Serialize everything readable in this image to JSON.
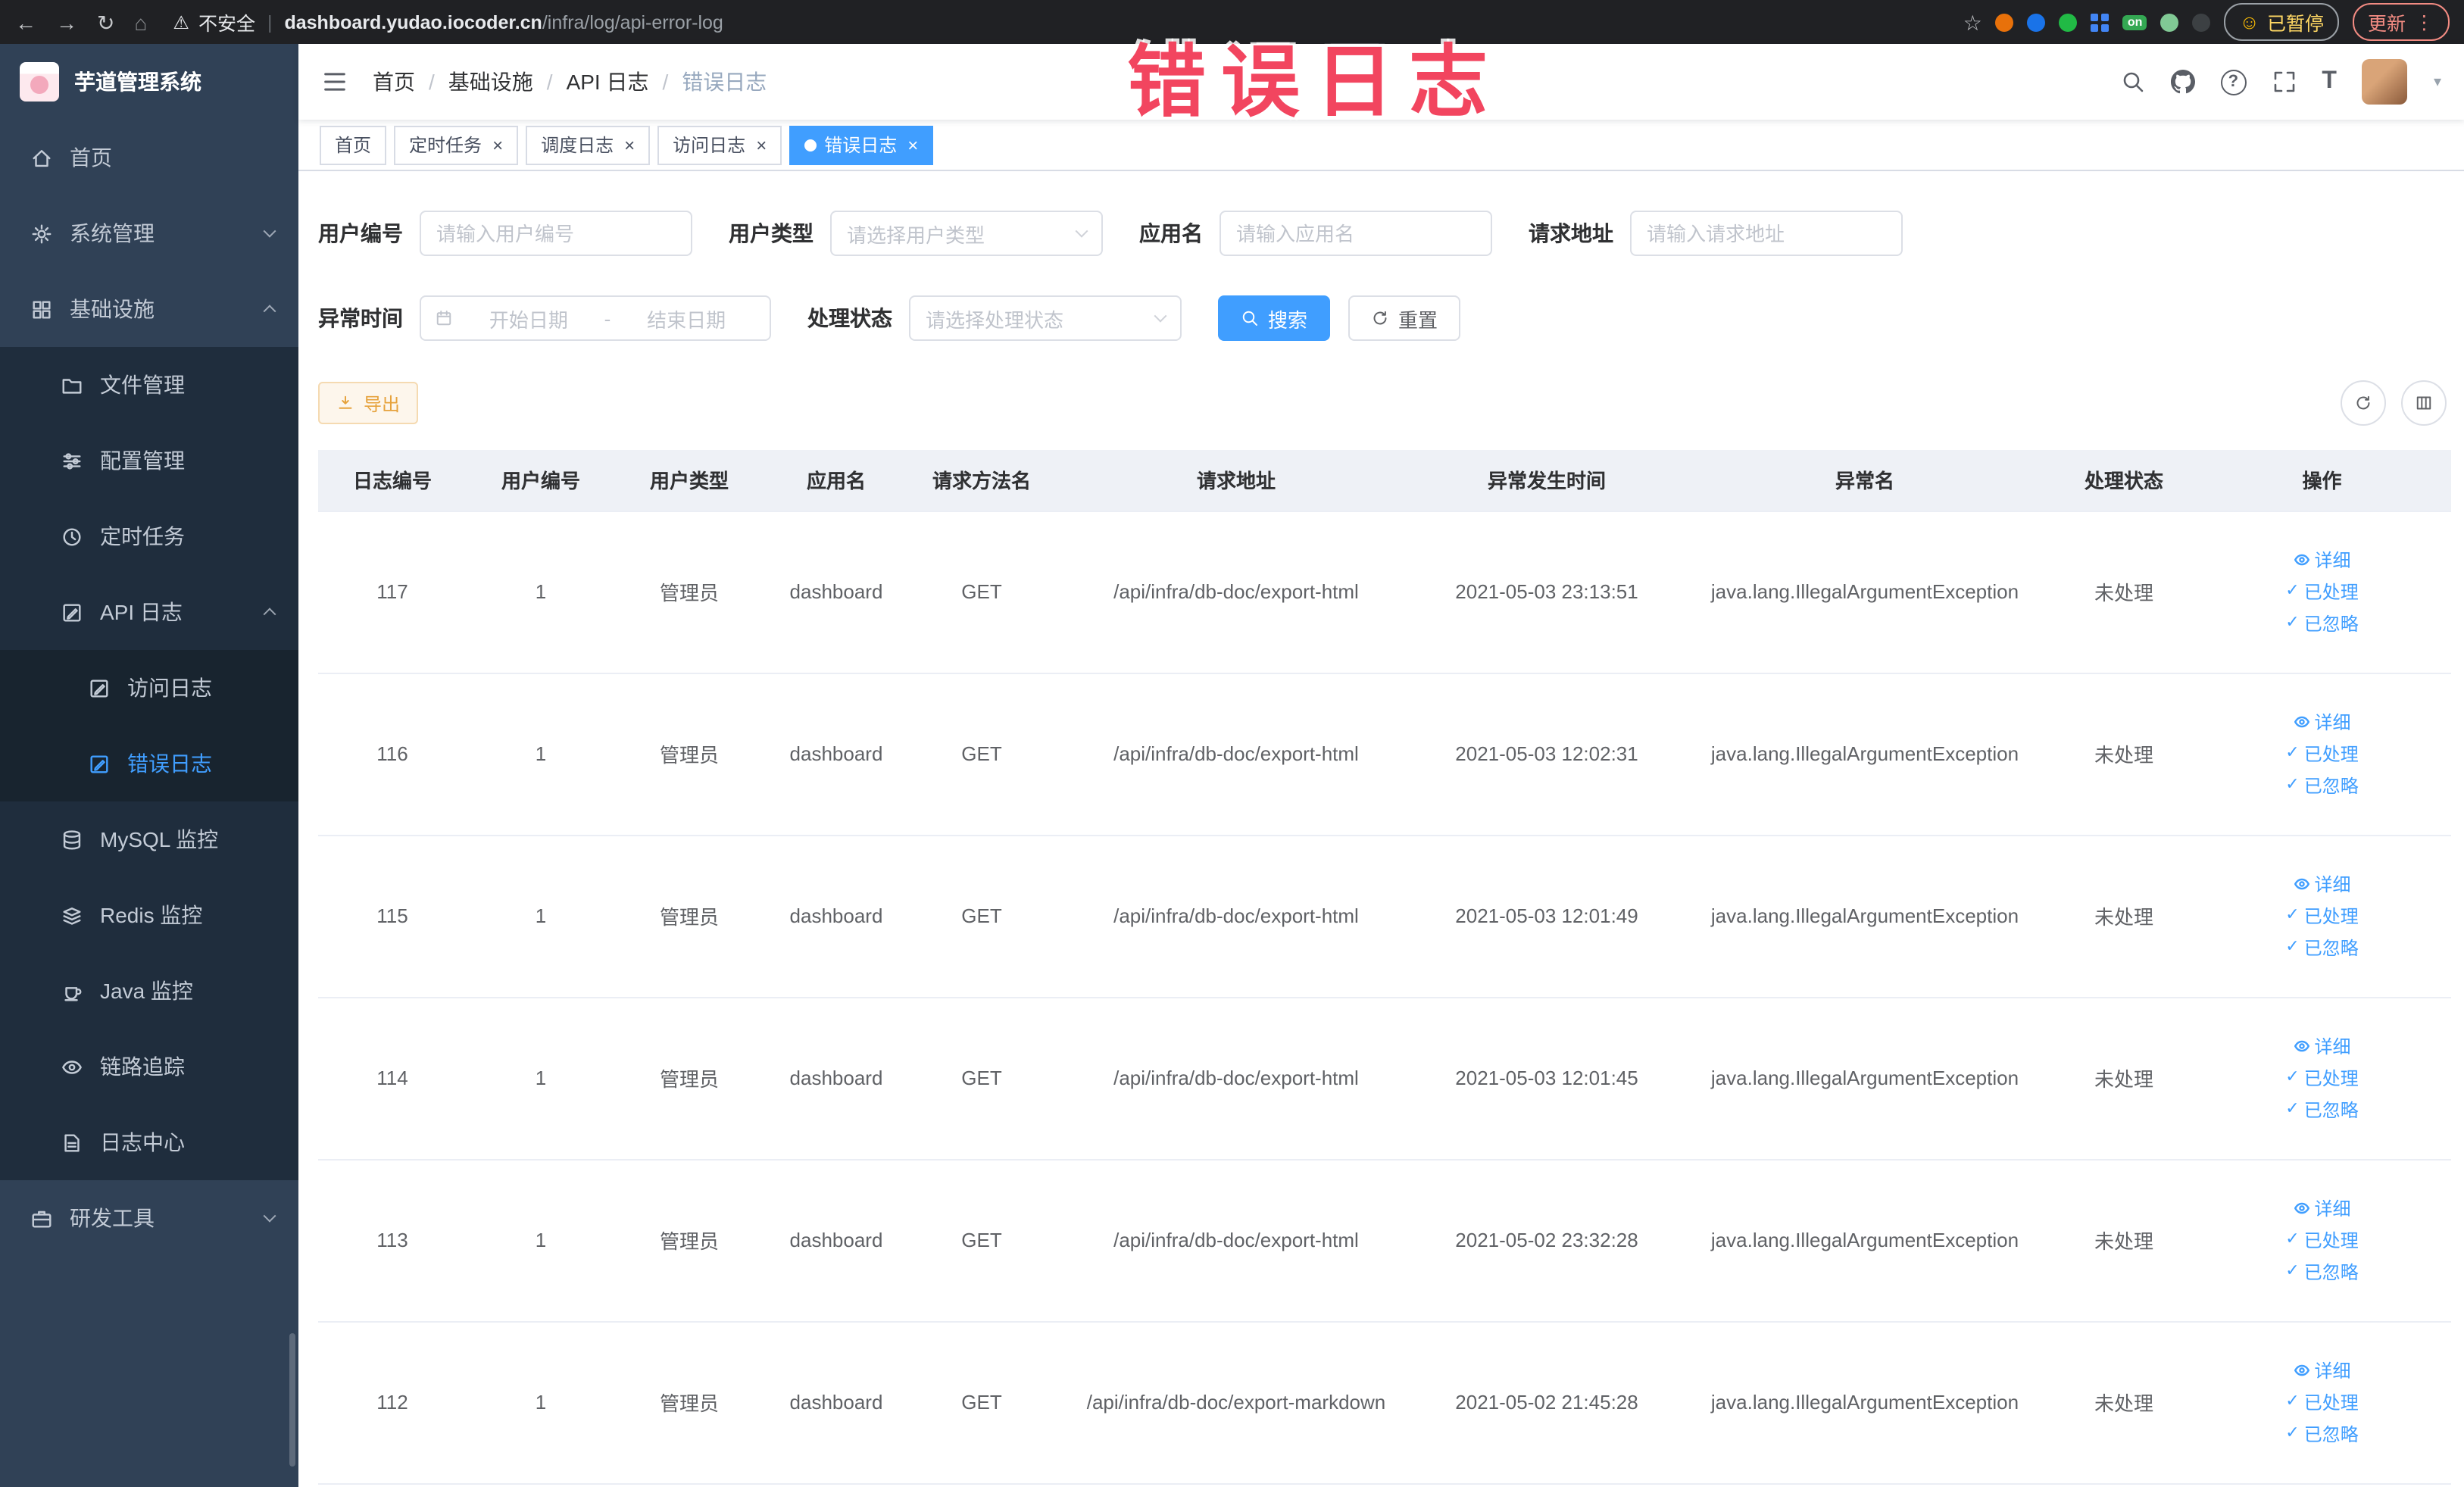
{
  "colors": {
    "primary": "#409EFF",
    "warning": "#E6A23C",
    "sidebar_bg": "#304156",
    "overlay_red": "#f2455f"
  },
  "icons": {
    "back": "←",
    "forward": "→",
    "refresh": "↻",
    "home": "⌂",
    "warning": "⚠",
    "star": "☆",
    "dots": "⋮",
    "smiley": "☺",
    "caret_down": "▾",
    "close": "×",
    "check": "✓",
    "help": "?",
    "font_size": "T"
  },
  "browser": {
    "security_label": "不安全",
    "url_domain": "dashboard.yudao.iocoder.cn",
    "url_path": "/infra/log/api-error-log",
    "extension_on_badge": "on",
    "paused_badge": "已暂停",
    "update_button": "更新"
  },
  "overlay_title": "错误日志",
  "sidebar": {
    "logo_title": "芋道管理系统",
    "items": [
      {
        "label": "首页"
      },
      {
        "label": "系统管理"
      },
      {
        "label": "基础设施"
      },
      {
        "label": "文件管理"
      },
      {
        "label": "配置管理"
      },
      {
        "label": "定时任务"
      },
      {
        "label": "API 日志"
      },
      {
        "label": "访问日志"
      },
      {
        "label": "错误日志"
      },
      {
        "label": "MySQL 监控"
      },
      {
        "label": "Redis 监控"
      },
      {
        "label": "Java 监控"
      },
      {
        "label": "链路追踪"
      },
      {
        "label": "日志中心"
      },
      {
        "label": "研发工具"
      }
    ]
  },
  "breadcrumb": {
    "items": [
      "首页",
      "基础设施",
      "API 日志",
      "错误日志"
    ]
  },
  "tabs": [
    {
      "label": "首页"
    },
    {
      "label": "定时任务"
    },
    {
      "label": "调度日志"
    },
    {
      "label": "访问日志"
    },
    {
      "label": "错误日志"
    }
  ],
  "filters": {
    "user_id_label": "用户编号",
    "user_id_placeholder": "请输入用户编号",
    "user_type_label": "用户类型",
    "user_type_placeholder": "请选择用户类型",
    "app_name_label": "应用名",
    "app_name_placeholder": "请输入应用名",
    "request_url_label": "请求地址",
    "request_url_placeholder": "请输入请求地址",
    "exception_time_label": "异常时间",
    "date_start_placeholder": "开始日期",
    "date_separator": "-",
    "date_end_placeholder": "结束日期",
    "process_status_label": "处理状态",
    "process_status_placeholder": "请选择处理状态",
    "search_button": "搜索",
    "reset_button": "重置"
  },
  "toolbar": {
    "export_button": "导出"
  },
  "table": {
    "columns": [
      "日志编号",
      "用户编号",
      "用户类型",
      "应用名",
      "请求方法名",
      "请求地址",
      "异常发生时间",
      "异常名",
      "处理状态",
      "操作"
    ],
    "action_detail": "详细",
    "action_processed": "已处理",
    "action_ignored": "已忽略",
    "rows": [
      {
        "id": "117",
        "user_id": "1",
        "user_type": "管理员",
        "app_name": "dashboard",
        "method": "GET",
        "url": "/api/infra/db-doc/export-html",
        "time": "2021-05-03 23:13:51",
        "exception": "java.lang.IllegalArgumentException",
        "status": "未处理"
      },
      {
        "id": "116",
        "user_id": "1",
        "user_type": "管理员",
        "app_name": "dashboard",
        "method": "GET",
        "url": "/api/infra/db-doc/export-html",
        "time": "2021-05-03 12:02:31",
        "exception": "java.lang.IllegalArgumentException",
        "status": "未处理"
      },
      {
        "id": "115",
        "user_id": "1",
        "user_type": "管理员",
        "app_name": "dashboard",
        "method": "GET",
        "url": "/api/infra/db-doc/export-html",
        "time": "2021-05-03 12:01:49",
        "exception": "java.lang.IllegalArgumentException",
        "status": "未处理"
      },
      {
        "id": "114",
        "user_id": "1",
        "user_type": "管理员",
        "app_name": "dashboard",
        "method": "GET",
        "url": "/api/infra/db-doc/export-html",
        "time": "2021-05-03 12:01:45",
        "exception": "java.lang.IllegalArgumentException",
        "status": "未处理"
      },
      {
        "id": "113",
        "user_id": "1",
        "user_type": "管理员",
        "app_name": "dashboard",
        "method": "GET",
        "url": "/api/infra/db-doc/export-html",
        "time": "2021-05-02 23:32:28",
        "exception": "java.lang.IllegalArgumentException",
        "status": "未处理"
      },
      {
        "id": "112",
        "user_id": "1",
        "user_type": "管理员",
        "app_name": "dashboard",
        "method": "GET",
        "url": "/api/infra/db-doc/export-markdown",
        "time": "2021-05-02 21:45:28",
        "exception": "java.lang.IllegalArgumentException",
        "status": "未处理"
      }
    ]
  }
}
